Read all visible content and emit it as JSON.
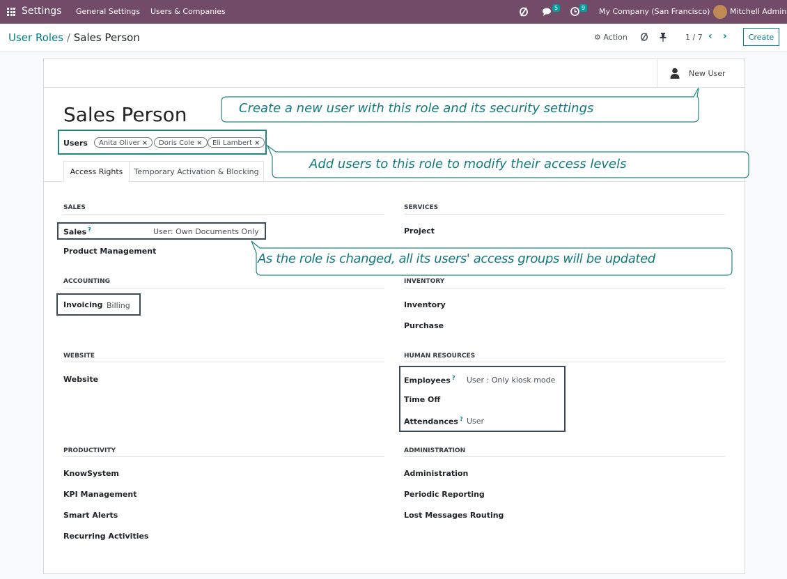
{
  "topbar": {
    "app_name": "Settings",
    "menus": [
      "General Settings",
      "Users & Companies"
    ],
    "messages_count": "5",
    "activities_count": "9",
    "company": "My Company (San Francisco)",
    "user": "Mitchell Admin"
  },
  "control": {
    "breadcrumb_parent": "User Roles",
    "breadcrumb_sep": "/",
    "breadcrumb_current": "Sales Person",
    "action_label": "Action",
    "pager": "1 / 7",
    "create_label": "Create"
  },
  "form": {
    "new_user_label": "New User",
    "title": "Sales Person",
    "users_label": "Users",
    "users": [
      "Anita Oliver",
      "Doris Cole",
      "Eli Lambert"
    ],
    "tabs": [
      "Access Rights",
      "Temporary Activation & Blocking"
    ],
    "sections": {
      "sales": {
        "heading": "SALES",
        "rows": [
          {
            "label": "Sales",
            "value": "User: Own Documents Only"
          },
          {
            "label": "Product Management",
            "value": ""
          }
        ]
      },
      "services": {
        "heading": "SERVICES",
        "rows": [
          {
            "label": "Project",
            "value": ""
          }
        ]
      },
      "accounting": {
        "heading": "ACCOUNTING",
        "rows": [
          {
            "label": "Invoicing",
            "value": "Billing"
          }
        ]
      },
      "inventory": {
        "heading": "INVENTORY",
        "rows": [
          {
            "label": "Inventory",
            "value": ""
          },
          {
            "label": "Purchase",
            "value": ""
          }
        ]
      },
      "website": {
        "heading": "WEBSITE",
        "rows": [
          {
            "label": "Website",
            "value": ""
          }
        ]
      },
      "hr": {
        "heading": "HUMAN RESOURCES",
        "rows": [
          {
            "label": "Employees",
            "value": "User : Only kiosk mode"
          },
          {
            "label": "Time Off",
            "value": ""
          },
          {
            "label": "Attendances",
            "value": "User"
          }
        ]
      },
      "productivity": {
        "heading": "PRODUCTIVITY",
        "rows": [
          {
            "label": "KnowSystem",
            "value": ""
          },
          {
            "label": "KPI Management",
            "value": ""
          },
          {
            "label": "Smart Alerts",
            "value": ""
          },
          {
            "label": "Recurring Activities",
            "value": ""
          }
        ]
      },
      "administration": {
        "heading": "ADMINISTRATION",
        "rows": [
          {
            "label": "Administration",
            "value": ""
          },
          {
            "label": "Periodic Reporting",
            "value": ""
          },
          {
            "label": "Lost Messages Routing",
            "value": ""
          }
        ]
      }
    }
  },
  "callouts": {
    "new_user": "Create a new user with this role and its security settings",
    "users": "Add users to this role to modify their access levels",
    "role_change": "As the role is changed, all its users' access groups will be updated"
  },
  "colors": {
    "brand": "#714b67",
    "accent": "#017e84",
    "callout": "#1f8780",
    "highlight_box": "#3c4a5c"
  }
}
